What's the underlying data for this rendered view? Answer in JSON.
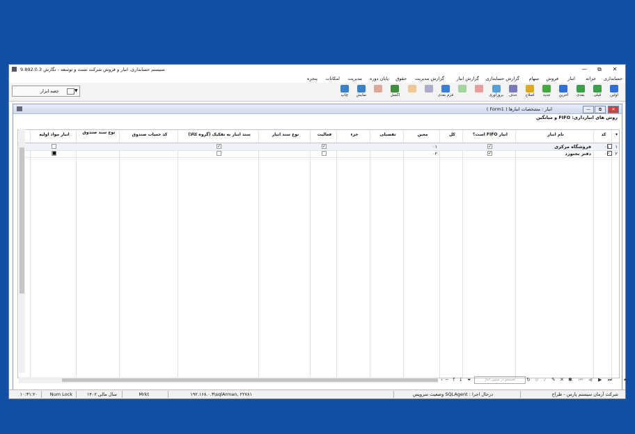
{
  "window": {
    "title": "سیستم حسابداری، انبار و فروش شرکت تست و توسعه - نگارش 9.892.0.3",
    "controls": {
      "close": "✕",
      "maximize": "⧉",
      "minimize": "—"
    }
  },
  "menu": [
    "حسابداری",
    "خزانه",
    "انبار",
    "فروش",
    "سهام",
    "گزارش حسابداری",
    "گزارش انبار",
    "گزارش مدیریت",
    "حقوق",
    "پایان دوره",
    "مدیریت",
    "امکانات",
    "پنجره"
  ],
  "toolbar": [
    {
      "label": "اولین",
      "color": "#2f6fd6",
      "icon": "first-icon",
      "enabled": true
    },
    {
      "label": "قبلی",
      "color": "#3aa14a",
      "icon": "previous-icon",
      "enabled": true
    },
    {
      "label": "بعدی",
      "color": "#3aa14a",
      "icon": "next-icon",
      "enabled": true
    },
    {
      "label": "آخرین",
      "color": "#2f6fd6",
      "icon": "last-icon",
      "enabled": true
    },
    {
      "label": "جدید",
      "color": "#46a640",
      "icon": "new-icon",
      "enabled": true
    },
    {
      "label": "اصلاح",
      "color": "#e0a81f",
      "icon": "edit-icon",
      "enabled": true
    },
    {
      "label": "حذف",
      "color": "#7a7ab8",
      "icon": "delete-icon",
      "enabled": true
    },
    {
      "label": "بروزآوری",
      "color": "#5aa0d8",
      "icon": "refresh-icon",
      "enabled": true
    },
    {
      "label": "",
      "color": "#d83a3a",
      "icon": "cancel-icon",
      "enabled": false
    },
    {
      "label": "",
      "color": "#4caa40",
      "icon": "confirm-icon",
      "enabled": false
    },
    {
      "label": "فرم بعدی",
      "color": "#3a7fd6",
      "icon": "next-form-icon",
      "enabled": true
    },
    {
      "label": "",
      "color": "#5a5a9a",
      "icon": "lock-icon",
      "enabled": false
    },
    {
      "label": "",
      "color": "#e8962a",
      "icon": "chart-icon",
      "enabled": false
    },
    {
      "label": "اکسل",
      "color": "#3f8f3f",
      "icon": "excel-icon",
      "enabled": true
    },
    {
      "label": "",
      "color": "#c05030",
      "icon": "pencil-icon",
      "enabled": false
    },
    {
      "label": "نمایش",
      "color": "#3a82c8",
      "icon": "preview-icon",
      "enabled": true
    },
    {
      "label": "چاپ",
      "color": "#3a82c8",
      "icon": "print-icon",
      "enabled": true
    }
  ],
  "combo": {
    "value": "جعبه ابزار"
  },
  "form": {
    "title": "انبار : مشخصات انبارها ( Form1 )",
    "subtitle": "روش های انبارداری: FIFO و میانگین"
  },
  "grid": {
    "columns": [
      "کد",
      "نام انبار",
      "انبار FIFO است؟",
      "کل",
      "معین",
      "تفصیلی",
      "جزء",
      "فعالیت",
      "نوع سند انبار",
      "سند انبار به تفکیک (گروه کالا)",
      "کد حساب صندوق",
      "نوع سند صندوق",
      "انبار مواد اولیه"
    ],
    "rows": [
      {
        "num": "۱",
        "code": "۰۱",
        "name": "فروشگاه مرکزی",
        "fifo": true,
        "moein": "۰۱",
        "faaliat": true,
        "tafkik": true,
        "mavad": false
      },
      {
        "num": "۲",
        "code": "۰۲",
        "name": "دفتر بجنورد",
        "fifo": true,
        "moein": "۰۲",
        "faaliat": false,
        "tafkik": false,
        "mavad": true
      }
    ]
  },
  "nav": {
    "search_placeholder": "جستجو در ستون انبار"
  },
  "status": {
    "company": "شرکت آرمان سیستم پارس - طراح",
    "service": "درحال اجرا : SQLAgent وضعیت سرویس",
    "server": "۱۹۲.۱۶۸.۰.۳\\sqlArman, ۲۲۷۸۱",
    "user": "Mrkt",
    "year": "سال مالی ۱۴۰۲",
    "numlock": "Num Lock",
    "time": "۱۰:۳۱:۲۰"
  }
}
